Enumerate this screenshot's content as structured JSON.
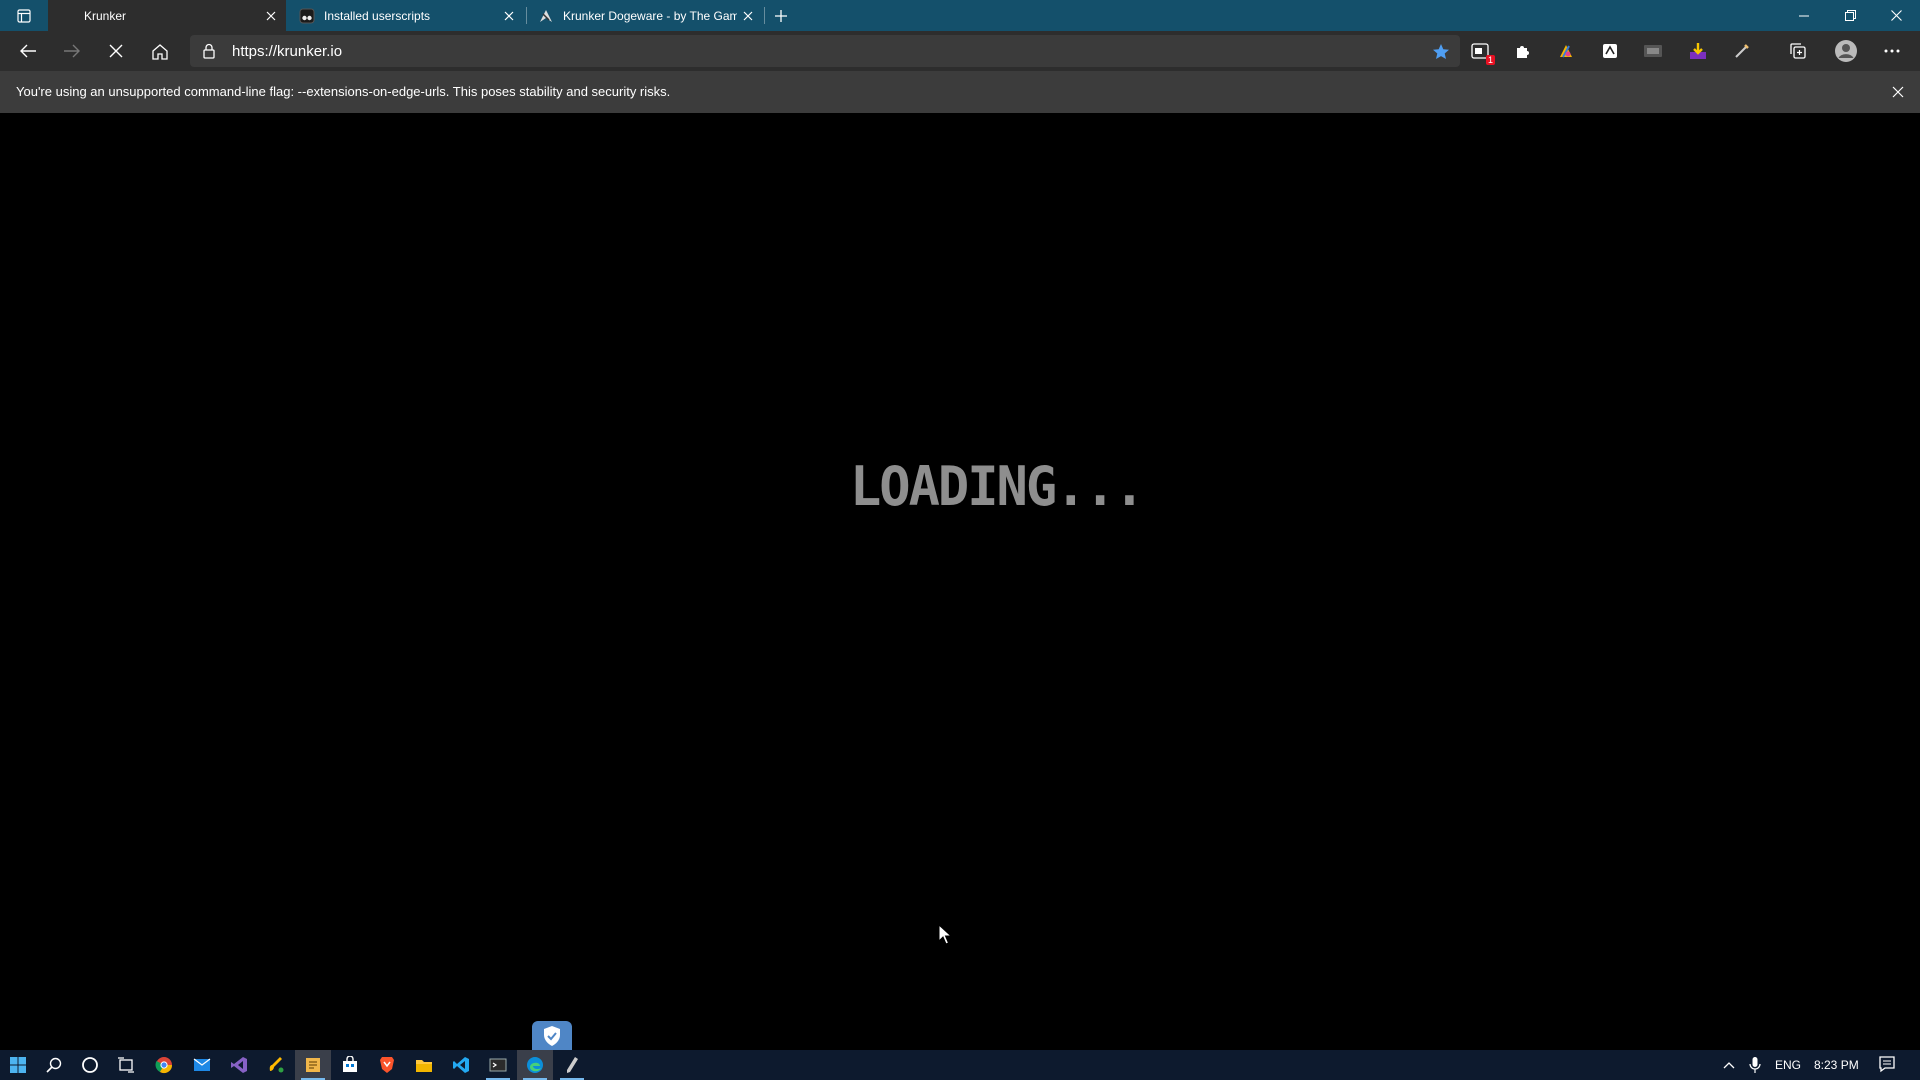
{
  "browser": {
    "tabs": [
      {
        "title": "Krunker",
        "active": true,
        "favicon": "none"
      },
      {
        "title": "Installed userscripts",
        "active": false,
        "favicon": "tampermonkey-icon"
      },
      {
        "title": "Krunker Dogeware - by The Gam",
        "active": false,
        "favicon": "dogeware-icon"
      }
    ],
    "url": "https://krunker.io",
    "loading": true,
    "info_bar": {
      "message": "You're using an unsupported command-line flag: --extensions-on-edge-urls. This poses stability and security risks."
    },
    "extensions": [
      {
        "name": "extension-badge-icon",
        "badge": "1"
      },
      {
        "name": "puzzle-icon"
      },
      {
        "name": "colorful-extension-icon"
      },
      {
        "name": "script-extension-icon"
      },
      {
        "name": "dark-extension-icon"
      },
      {
        "name": "download-extension-icon"
      },
      {
        "name": "pen-extension-icon"
      }
    ]
  },
  "page": {
    "loading_text": "LOADING..."
  },
  "taskbar": {
    "apps": [
      "start-icon",
      "search-icon",
      "cortana-icon",
      "task-view-icon",
      "chrome-icon",
      "mail-icon",
      "visual-studio-icon",
      "paint-icon",
      "sticky-app-icon",
      "store-icon",
      "brave-icon",
      "file-explorer-icon",
      "vscode-icon",
      "terminal-icon",
      "edge-icon",
      "pen-tool-icon"
    ],
    "language": "ENG",
    "time": "8:23 PM"
  },
  "colors": {
    "titlebar": "#14506b",
    "toolbar": "#2d2d2d",
    "infobar": "#3c3c3c",
    "accent": "#76b9ed",
    "loading_text": "#8e8e8e"
  }
}
